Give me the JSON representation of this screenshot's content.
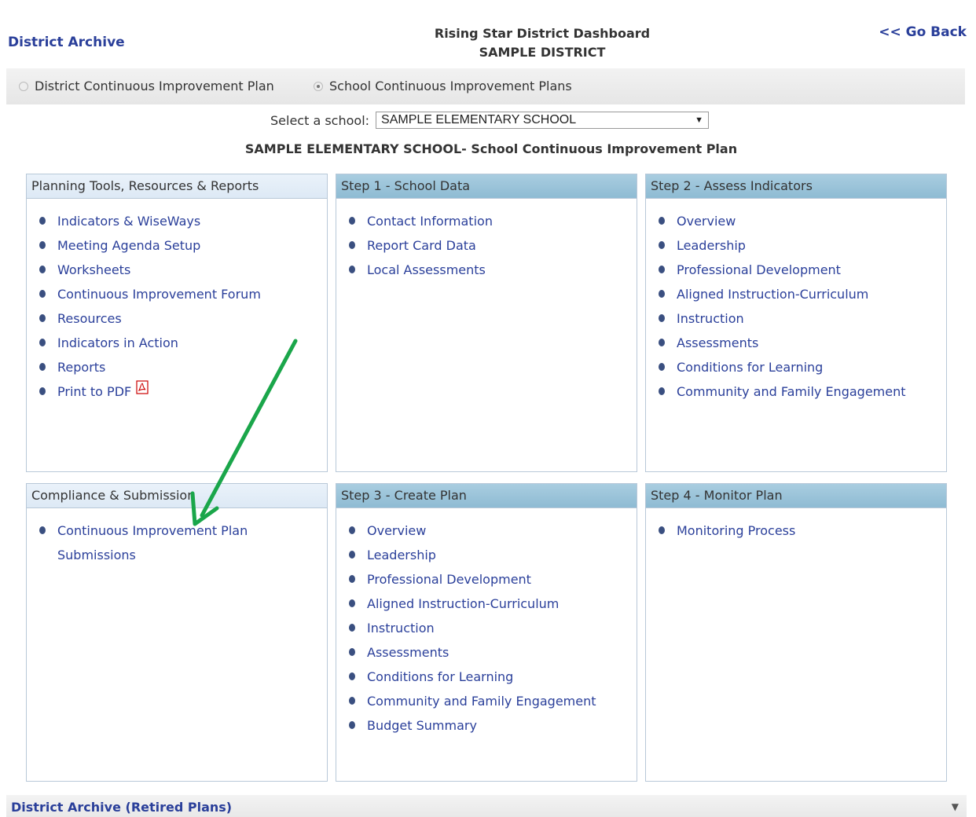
{
  "header": {
    "district_archive": "District Archive",
    "title": "Rising Star District Dashboard",
    "subtitle": "SAMPLE DISTRICT",
    "go_back": "<< Go Back"
  },
  "plan_toggle": {
    "district_label": "District Continuous Improvement Plan",
    "school_label": "School Continuous Improvement Plans",
    "selected": "school"
  },
  "school_select": {
    "label": "Select a school:",
    "value": "SAMPLE ELEMENTARY SCHOOL"
  },
  "plan_title": "SAMPLE ELEMENTARY SCHOOL- School Continuous Improvement Plan",
  "panels": {
    "planning": {
      "title": "Planning Tools, Resources & Reports",
      "items": [
        "Indicators & WiseWays",
        "Meeting Agenda Setup",
        "Worksheets",
        "Continuous Improvement Forum",
        "Resources",
        "Indicators in Action",
        "Reports",
        "Print to PDF"
      ]
    },
    "step1": {
      "title": "Step 1 - School Data",
      "items": [
        "Contact Information",
        "Report Card Data",
        "Local Assessments"
      ]
    },
    "step2": {
      "title": "Step 2 - Assess Indicators",
      "items": [
        "Overview",
        "Leadership",
        "Professional Development",
        "Aligned Instruction-Curriculum",
        "Instruction",
        "Assessments",
        "Conditions for Learning",
        "Community and Family Engagement"
      ]
    },
    "compliance": {
      "title": "Compliance & Submission",
      "items": [
        "Continuous Improvement Plan",
        "Submissions"
      ]
    },
    "step3": {
      "title": "Step 3 - Create Plan",
      "items": [
        "Overview",
        "Leadership",
        "Professional Development",
        "Aligned Instruction-Curriculum",
        "Instruction",
        "Assessments",
        "Conditions for Learning",
        "Community and Family Engagement",
        "Budget Summary"
      ]
    },
    "step4": {
      "title": "Step 4 - Monitor Plan",
      "items": [
        "Monitoring Process"
      ]
    }
  },
  "footer": {
    "archive_label": "District Archive (Retired Plans)"
  },
  "colors": {
    "link": "#2a3f9a",
    "panel_header_light": "#dde9f5",
    "panel_header_dark": "#8ebbd3",
    "annotation_arrow": "#1aa64a"
  }
}
